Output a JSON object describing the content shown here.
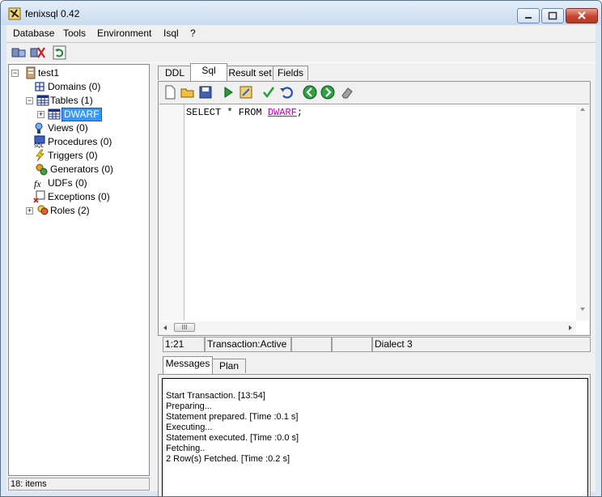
{
  "window": {
    "title": "fenixsql 0.42"
  },
  "menu": [
    "Database",
    "Tools",
    "Environment",
    "Isql",
    "?"
  ],
  "toolbar": {
    "icons": [
      "connect-icon",
      "disconnect-icon",
      "refresh-icon"
    ]
  },
  "tree": {
    "root": "test1",
    "items": [
      {
        "label": "Domains (0)",
        "icon": "domains-icon"
      },
      {
        "label": "Tables (1)",
        "icon": "tables-icon"
      },
      {
        "label": "DWARF",
        "icon": "table-icon"
      },
      {
        "label": "Views (0)",
        "icon": "views-icon"
      },
      {
        "label": "Procedures (0)",
        "icon": "procedures-icon"
      },
      {
        "label": "Triggers (0)",
        "icon": "triggers-icon"
      },
      {
        "label": "Generators (0)",
        "icon": "generators-icon"
      },
      {
        "label": "UDFs (0)",
        "icon": "udfs-icon"
      },
      {
        "label": "Exceptions (0)",
        "icon": "exceptions-icon"
      },
      {
        "label": "Roles (2)",
        "icon": "roles-icon"
      }
    ]
  },
  "status_left": "18: items",
  "tabs": [
    "DDL",
    "Sql",
    "Result set",
    "Fields"
  ],
  "active_tab": "Sql",
  "editor": {
    "code_prefix": "SELECT * FROM ",
    "code_table": "DWARF",
    "code_suffix": ";",
    "scroll_grip": "III"
  },
  "statusbar": {
    "position": "1:21",
    "transaction": "Transaction:Active",
    "cell3": "",
    "cell4": "",
    "dialect": "Dialect 3"
  },
  "bottom_tabs": [
    "Messages",
    "Plan"
  ],
  "messages": [
    "Start Transaction. [13:54]",
    "Preparing...",
    "Statement prepared. [Time :0.1 s]",
    "Executing...",
    "Statement executed. [Time :0.0 s]",
    "Fetching..",
    "2 Row(s) Fetched. [Time :0.2 s]"
  ],
  "colors": {
    "selection": "#3399ff",
    "table_keyword": "#c000c0",
    "close_button": "#c7452f"
  }
}
